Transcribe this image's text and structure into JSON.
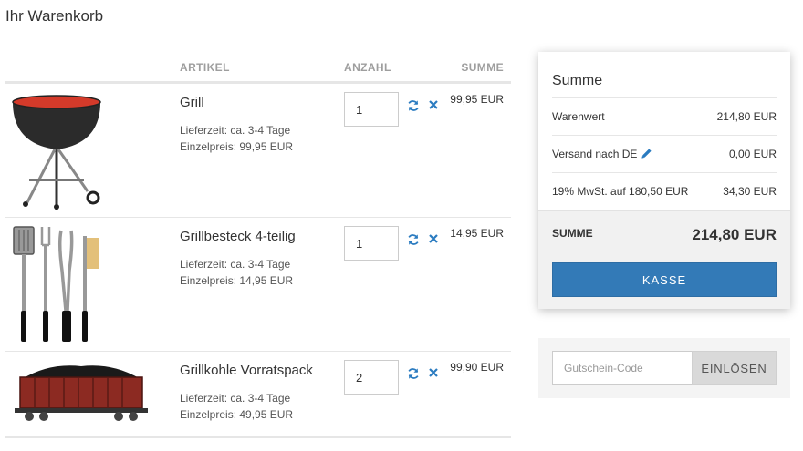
{
  "page": {
    "title": "Ihr Warenkorb"
  },
  "table": {
    "headers": {
      "item": "ARTIKEL",
      "quantity": "ANZAHL",
      "total": "SUMME"
    },
    "rows": [
      {
        "name": "Grill",
        "delivery": "Lieferzeit: ca. 3-4 Tage",
        "unit_price": "Einzelpreis: 99,95 EUR",
        "quantity": "1",
        "line_total": "99,95 EUR",
        "image": "kettle-grill"
      },
      {
        "name": "Grillbesteck 4-teilig",
        "delivery": "Lieferzeit: ca. 3-4 Tage",
        "unit_price": "Einzelpreis: 14,95 EUR",
        "quantity": "1",
        "line_total": "14,95 EUR",
        "image": "grill-tools"
      },
      {
        "name": "Grillkohle Vorratspack",
        "delivery": "Lieferzeit: ca. 3-4 Tage",
        "unit_price": "Einzelpreis: 49,95 EUR",
        "quantity": "2",
        "line_total": "99,90 EUR",
        "image": "coal-wagon"
      }
    ],
    "row_icons": {
      "update": "refresh-icon",
      "remove": "close-icon"
    }
  },
  "summary": {
    "title": "Summe",
    "lines": [
      {
        "label": "Warenwert",
        "value": "214,80 EUR"
      },
      {
        "label": "Versand nach DE",
        "value": "0,00 EUR",
        "icon": "pencil-icon"
      },
      {
        "label": "19% MwSt. auf 180,50 EUR",
        "value": "34,30 EUR"
      }
    ],
    "total_label": "SUMME",
    "total_value": "214,80 EUR",
    "checkout_label": "KASSE"
  },
  "coupon": {
    "placeholder": "Gutschein-Code",
    "value": "",
    "button_label": "EINLÖSEN"
  },
  "colors": {
    "accent": "#337ab7",
    "icon_blue": "#2a7bc0",
    "grill_red": "#d43a2a"
  }
}
